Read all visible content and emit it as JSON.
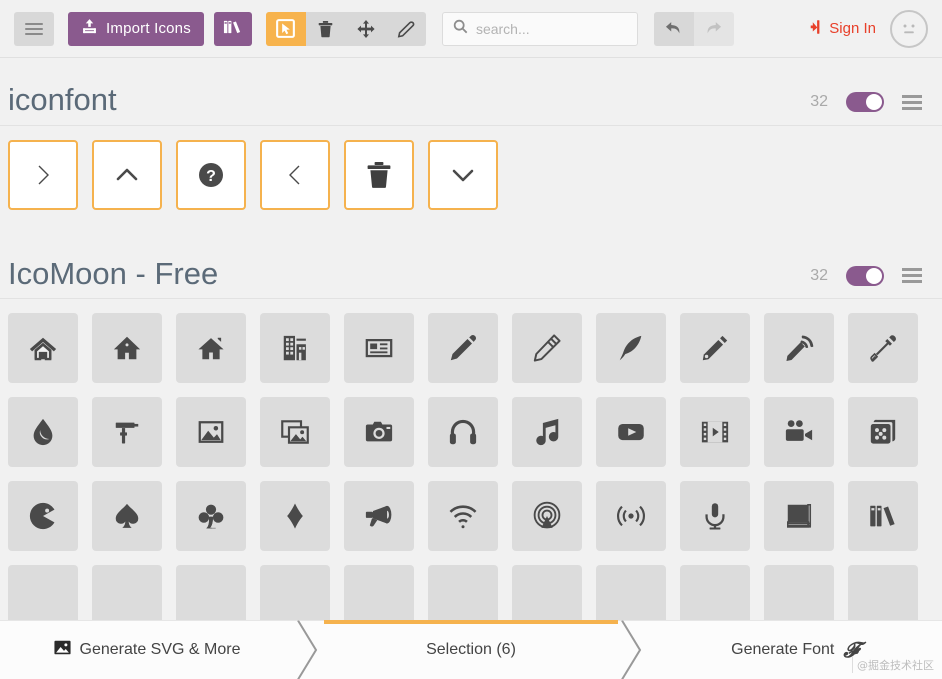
{
  "toolbar": {
    "menu_icon": "hamburger-icon",
    "import_label": "Import Icons",
    "import_icon": "upload-icon",
    "library_icon": "books-icon",
    "tools": [
      {
        "name": "select",
        "icon": "cursor-select-icon",
        "active": true
      },
      {
        "name": "delete",
        "icon": "trash-icon",
        "active": false
      },
      {
        "name": "move",
        "icon": "move-icon",
        "active": false
      },
      {
        "name": "edit",
        "icon": "pencil-icon",
        "active": false
      }
    ],
    "search": {
      "placeholder": "search...",
      "value": "",
      "icon": "search-icon"
    },
    "undo": {
      "icon": "undo-arrow-icon",
      "enabled": true
    },
    "redo": {
      "icon": "redo-arrow-icon",
      "enabled": false
    },
    "signin_label": "Sign In",
    "signin_icon": "sign-in-icon",
    "avatar_icon": "neutral-face-icon",
    "accent_purple": "#8a5a8e",
    "accent_orange": "#f7b34d",
    "accent_red": "#e8402a"
  },
  "sets": [
    {
      "title": "iconfont",
      "count": "32",
      "toggle_on": true,
      "menu_icon": "list-menu-icon",
      "icons": [
        {
          "name": "chevron-right-icon",
          "selected": true
        },
        {
          "name": "chevron-up-icon",
          "selected": true
        },
        {
          "name": "question-circle-icon",
          "selected": true
        },
        {
          "name": "chevron-left-icon",
          "selected": true
        },
        {
          "name": "trash-icon",
          "selected": true
        },
        {
          "name": "chevron-down-icon",
          "selected": true
        }
      ]
    },
    {
      "title": "IcoMoon - Free",
      "count": "32",
      "toggle_on": true,
      "menu_icon": "list-menu-icon",
      "icons": [
        {
          "name": "home-icon",
          "selected": false
        },
        {
          "name": "home2-icon",
          "selected": false
        },
        {
          "name": "home3-icon",
          "selected": false
        },
        {
          "name": "office-icon",
          "selected": false
        },
        {
          "name": "newspaper-icon",
          "selected": false
        },
        {
          "name": "pencil-icon",
          "selected": false
        },
        {
          "name": "pencil2-icon",
          "selected": false
        },
        {
          "name": "quill-icon",
          "selected": false
        },
        {
          "name": "pen-icon",
          "selected": false
        },
        {
          "name": "blog-icon",
          "selected": false
        },
        {
          "name": "eyedropper-icon",
          "selected": false
        },
        {
          "name": "droplet-icon",
          "selected": false
        },
        {
          "name": "paint-format-icon",
          "selected": false
        },
        {
          "name": "image-icon",
          "selected": false
        },
        {
          "name": "images-icon",
          "selected": false
        },
        {
          "name": "camera-icon",
          "selected": false
        },
        {
          "name": "headphones-icon",
          "selected": false
        },
        {
          "name": "music-icon",
          "selected": false
        },
        {
          "name": "play-icon",
          "selected": false
        },
        {
          "name": "film-icon",
          "selected": false
        },
        {
          "name": "video-camera-icon",
          "selected": false
        },
        {
          "name": "dice-icon",
          "selected": false
        },
        {
          "name": "pacman-icon",
          "selected": false
        },
        {
          "name": "spades-icon",
          "selected": false
        },
        {
          "name": "clubs-icon",
          "selected": false
        },
        {
          "name": "diamonds-icon",
          "selected": false
        },
        {
          "name": "bullhorn-icon",
          "selected": false
        },
        {
          "name": "connection-icon",
          "selected": false
        },
        {
          "name": "podcast-icon",
          "selected": false
        },
        {
          "name": "feed-icon",
          "selected": false
        },
        {
          "name": "mic-icon",
          "selected": false
        },
        {
          "name": "book-icon",
          "selected": false
        },
        {
          "name": "books-icon",
          "selected": false
        }
      ]
    }
  ],
  "bottombar": {
    "generate_svg_label": "Generate SVG & More",
    "generate_svg_icon": "image-icon",
    "selection_label": "Selection (6)",
    "selection_icon": "file-icon",
    "generate_font_label": "Generate Font",
    "generate_font_icon": "font-f-icon",
    "active_segment": "selection"
  },
  "watermark": "@掘金技术社区"
}
